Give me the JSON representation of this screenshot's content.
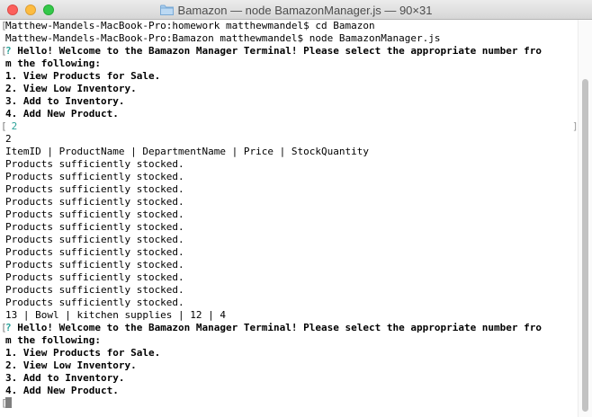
{
  "window": {
    "title": "Bamazon — node BamazonManager.js — 90×31"
  },
  "icons": {
    "title_folder": "folder-icon",
    "close": "close-icon",
    "minimize": "minimize-icon",
    "zoom": "zoom-icon"
  },
  "colors": {
    "close": "#fc605c",
    "minimize": "#fdbc40",
    "zoom": "#34c84a",
    "prompt_accent": "#2aa198"
  },
  "terminal": {
    "cmd1": "Matthew-Mandels-MacBook-Pro:homework matthewmandel$ cd Bamazon",
    "cmd2": "Matthew-Mandels-MacBook-Pro:Bamazon matthewmandel$ node BamazonManager.js",
    "q1_mark": "?",
    "q1_line1": "Hello! Welcome to the Bamazon Manager Terminal! Please select the appropriate number fro",
    "q1_line2": "m the following:",
    "m1_opt1": "1. View Products for Sale.",
    "m1_opt2": "2. View Low Inventory.",
    "m1_opt3": "3. Add to Inventory.",
    "m1_opt4": "4. Add New Product.",
    "answer_input": "2",
    "echo": "2",
    "table_header": "ItemID | ProductName | DepartmentName | Price | StockQuantity",
    "stock_msgs": [
      "Products sufficiently stocked.",
      "Products sufficiently stocked.",
      "Products sufficiently stocked.",
      "Products sufficiently stocked.",
      "Products sufficiently stocked.",
      "Products sufficiently stocked.",
      "Products sufficiently stocked.",
      "Products sufficiently stocked.",
      "Products sufficiently stocked.",
      "Products sufficiently stocked.",
      "Products sufficiently stocked.",
      "Products sufficiently stocked."
    ],
    "low_item": "13 | Bowl | kitchen supplies | 12 | 4",
    "q2_mark": "?",
    "q2_line1": "Hello! Welcome to the Bamazon Manager Terminal! Please select the appropriate number fro",
    "q2_line2": "m the following:",
    "m2_opt1": "1. View Products for Sale.",
    "m2_opt2": "2. View Low Inventory.",
    "m2_opt3": "3. Add to Inventory.",
    "m2_opt4": "4. Add New Product."
  }
}
